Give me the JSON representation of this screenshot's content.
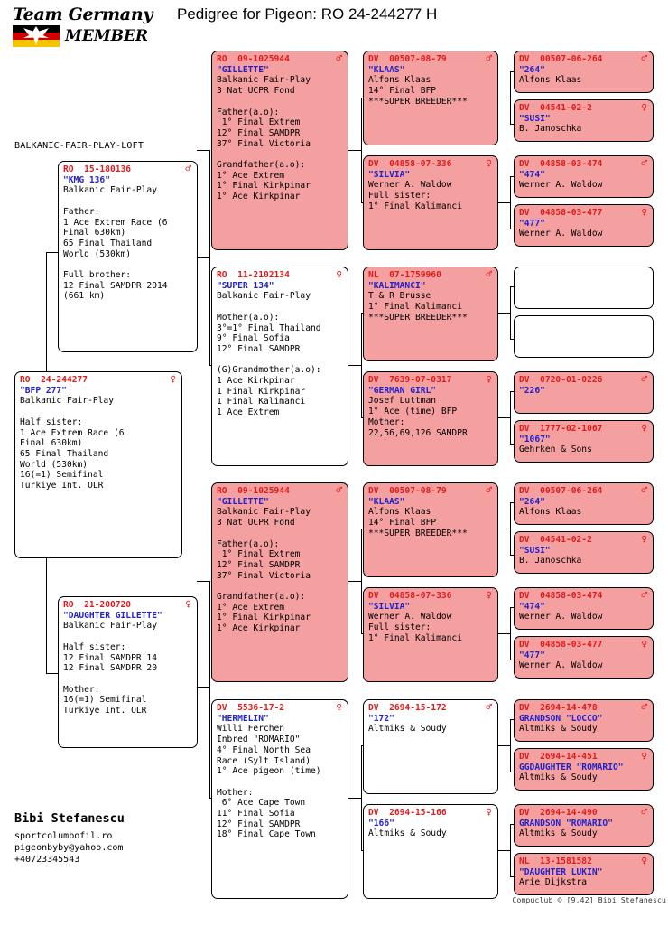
{
  "header": {
    "logo_line1": "Team Germany",
    "logo_line2": "MEMBER",
    "title": "Pedigree for Pigeon: RO  24-244277 H"
  },
  "loft_label": "BALKANIC-FAIR-PLAY-LOFT",
  "symbols": {
    "male": "♂",
    "female": "♀"
  },
  "subject": {
    "ring": "RO  24-244277",
    "sex": "female",
    "name": "\"BFP 277\"",
    "body": "Balkanic Fair-Play\n\nHalf sister:\n1 Ace Extrem Race (6\nFinal 630km)\n65 Final Thailand\nWorld (530km)\n16(=1) Semifinal\nTurkiye Int. OLR"
  },
  "parents": [
    {
      "ring": "RO  15-180136",
      "sex": "male",
      "name": "\"KMG 136\"",
      "body": "Balkanic Fair-Play\n\nFather:\n1 Ace Extrem Race (6\nFinal 630km)\n65 Final Thailand\nWorld (530km)\n\nFull brother:\n12 Final SAMDPR 2014\n(661 km)"
    },
    {
      "ring": "RO  21-200720",
      "sex": "female",
      "name": "\"DAUGHTER GILLETTE\"",
      "body": "Balkanic Fair-Play\n\nHalf sister:\n12 Final SAMDPR'14\n12 Final SAMDPR'20\n\nMother:\n16(=1) Semifinal\nTurkiye Int. OLR"
    }
  ],
  "grandparents": [
    {
      "ring": "RO  09-1025944",
      "sex": "male",
      "name": "\"GILLETTE\"",
      "fill": "pink",
      "body": "Balkanic Fair-Play\n3 Nat UCPR Fond\n\nFather(a.o):\n 1° Final Extrem\n12° Final SAMDPR\n37° Final Victoria\n\nGrandfather(a.o):\n1° Ace Extrem\n1° Final Kirkpinar\n1° Ace Kirkpinar"
    },
    {
      "ring": "RO  11-2102134",
      "sex": "female",
      "name": "\"SUPER 134\"",
      "fill": "white",
      "body": "Balkanic Fair-Play\n\nMother(a.o):\n3°=1° Final Thailand\n9° Final Sofia\n12° Final SAMDPR\n\n(G)Grandmother(a.o):\n1 Ace Kirkpinar\n1 Final Kirkpinar\n1 Final Kalimanci\n1 Ace Extrem"
    },
    {
      "ring": "RO  09-1025944",
      "sex": "male",
      "name": "\"GILLETTE\"",
      "fill": "pink",
      "body": "Balkanic Fair-Play\n3 Nat UCPR Fond\n\nFather(a.o):\n 1° Final Extrem\n12° Final SAMDPR\n37° Final Victoria\n\nGrandfather(a.o):\n1° Ace Extrem\n1° Final Kirkpinar\n1° Ace Kirkpinar"
    },
    {
      "ring": "DV  5536-17-2",
      "sex": "female",
      "name": "\"HERMELIN\"",
      "fill": "white",
      "body": "Willi Ferchen\nInbred \"ROMARIO\"\n4° Final North Sea\nRace (Sylt Island)\n1° Ace pigeon (time)\n\nMother:\n 6° Ace Cape Town\n11° Final Sofia\n12° Final SAMDPR\n18° Final Cape Town"
    }
  ],
  "greatgrandparents": [
    {
      "ring": "DV  00507-08-79",
      "sex": "male",
      "name": "\"KLAAS\"",
      "fill": "pink",
      "body": "Alfons Klaas\n14° Final BFP\n***SUPER BREEDER***"
    },
    {
      "ring": "DV  04858-07-336",
      "sex": "female",
      "name": "\"SILVIA\"",
      "fill": "pink",
      "body": "Werner A. Waldow\nFull sister:\n1° Final Kalimanci"
    },
    {
      "ring": "NL  07-1759960",
      "sex": "male",
      "name": "\"KALIMANCI\"",
      "fill": "pink",
      "body": "T & R Brusse\n1° Final Kalimanci\n***SUPER BREEDER***"
    },
    {
      "ring": "DV  7639-07-0317",
      "sex": "female",
      "name": "\"GERMAN GIRL\"",
      "fill": "pink",
      "body": "Josef Luttman\n1° Ace (time) BFP\nMother:\n22,56,69,126 SAMDPR"
    },
    {
      "ring": "DV  00507-08-79",
      "sex": "male",
      "name": "\"KLAAS\"",
      "fill": "pink",
      "body": "Alfons Klaas\n14° Final BFP\n***SUPER BREEDER***"
    },
    {
      "ring": "DV  04858-07-336",
      "sex": "female",
      "name": "\"SILVIA\"",
      "fill": "pink",
      "body": "Werner A. Waldow\nFull sister:\n1° Final Kalimanci"
    },
    {
      "ring": "DV  2694-15-172",
      "sex": "male",
      "name": "\"172\"",
      "fill": "white",
      "body": "Altmiks & Soudy"
    },
    {
      "ring": "DV  2694-15-166",
      "sex": "female",
      "name": "\"166\"",
      "fill": "white",
      "body": "Altmiks & Soudy"
    }
  ],
  "gggrandparents": [
    {
      "ring": "DV  00507-06-264",
      "sex": "male",
      "name": "\"264\"",
      "fill": "pink",
      "body": "Alfons Klaas"
    },
    {
      "ring": "DV  04541-02-2",
      "sex": "female",
      "name": "\"SUSI\"",
      "fill": "pink",
      "body": "B. Janoschka"
    },
    {
      "ring": "DV  04858-03-474",
      "sex": "male",
      "name": "\"474\"",
      "fill": "pink",
      "body": "Werner A. Waldow"
    },
    {
      "ring": "DV  04858-03-477",
      "sex": "female",
      "name": "\"477\"",
      "fill": "pink",
      "body": "Werner A. Waldow"
    },
    {
      "ring": "",
      "sex": "",
      "name": "",
      "fill": "white",
      "body": ""
    },
    {
      "ring": "",
      "sex": "",
      "name": "",
      "fill": "white",
      "body": ""
    },
    {
      "ring": "DV  0720-01-0226",
      "sex": "male",
      "name": "\"226\"",
      "fill": "pink",
      "body": ""
    },
    {
      "ring": "DV  1777-02-1067",
      "sex": "female",
      "name": "\"1067\"",
      "fill": "pink",
      "body": "Gehrken & Sons"
    },
    {
      "ring": "DV  00507-06-264",
      "sex": "male",
      "name": "\"264\"",
      "fill": "pink",
      "body": "Alfons Klaas"
    },
    {
      "ring": "DV  04541-02-2",
      "sex": "female",
      "name": "\"SUSI\"",
      "fill": "pink",
      "body": "B. Janoschka"
    },
    {
      "ring": "DV  04858-03-474",
      "sex": "male",
      "name": "\"474\"",
      "fill": "pink",
      "body": "Werner A. Waldow"
    },
    {
      "ring": "DV  04858-03-477",
      "sex": "female",
      "name": "\"477\"",
      "fill": "pink",
      "body": "Werner A. Waldow"
    },
    {
      "ring": "DV  2694-14-478",
      "sex": "male",
      "name": "GRANDSON \"LOCCO\"",
      "fill": "pink",
      "body": "Altmiks & Soudy"
    },
    {
      "ring": "DV  2694-14-451",
      "sex": "female",
      "name": "GGDAUGHTER \"ROMARIO\"",
      "fill": "pink",
      "body": "Altmiks & Soudy"
    },
    {
      "ring": "DV  2694-14-490",
      "sex": "male",
      "name": "GRANDSON \"ROMARIO\"",
      "fill": "pink",
      "body": "Altmiks & Soudy"
    },
    {
      "ring": "NL  13-1581582",
      "sex": "female",
      "name": "\"DAUGHTER LUKIN\"",
      "fill": "pink",
      "body": "Arie Dijkstra"
    }
  ],
  "owner": {
    "name": "Bibi Stefanescu",
    "website": "sportcolumbofil.ro",
    "email": "pigeonbyby@yahoo.com",
    "phone": "+40723345543"
  },
  "compuclub": "Compuclub © [9.42]  Bibi Stefanescu",
  "colors": {
    "pink": "#f4a0a0",
    "ring_red": "#e01b1b",
    "name_blue": "#2222cc"
  }
}
